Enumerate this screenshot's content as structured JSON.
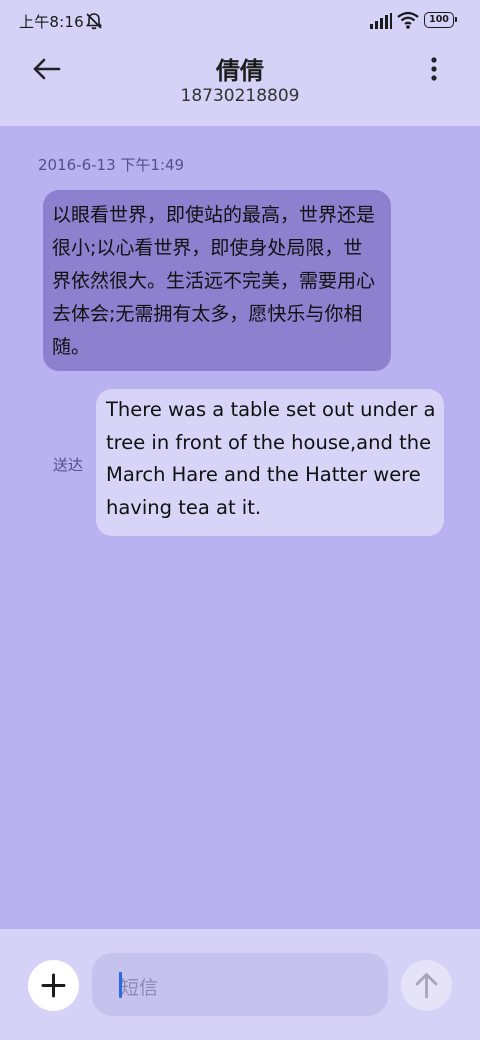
{
  "status_bar": {
    "time": "上午8:16",
    "battery": "100",
    "icons": [
      "mute-bell-icon",
      "signal-icon",
      "wifi-icon",
      "battery-icon"
    ]
  },
  "header": {
    "contact_name": "倩倩",
    "contact_number": "18730218809",
    "back_icon": "back-arrow-icon",
    "more_icon": "more-vertical-icon"
  },
  "conversation": {
    "timestamp": "2016-6-13 下午1:49",
    "received_message": "以眼看世界，即使站的最高，世界还是很小;以心看世界，即使身处局限，世界依然很大。生活远不完美，需要用心去体会;无需拥有太多，愿快乐与你相随。",
    "sent_status": "送达",
    "sent_message": "There was a table set out under a tree in front of the house,and the March Hare and the Hatter were having tea at it."
  },
  "composer": {
    "placeholder": "短信",
    "add_icon": "plus-icon",
    "send_icon": "arrow-up-icon"
  },
  "colors": {
    "header_bg": "#d5d1f7",
    "chat_bg": "#b9b2f1",
    "received_bubble": "#8d80cf",
    "sent_bubble": "#d8d4f8",
    "cursor": "#2a6be0"
  }
}
